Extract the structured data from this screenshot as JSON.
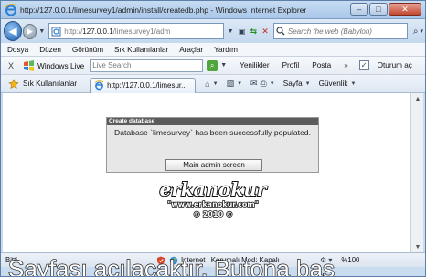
{
  "window": {
    "title": "http://127.0.0.1/limesurvey1/admin/install/createdb.php - Windows Internet Explorer",
    "minimize": "–",
    "maximize": "□",
    "close": "✕"
  },
  "nav": {
    "address_dim_prefix": "http://",
    "address_host": "127.0.0.1",
    "address_dim_suffix": "/limesurvey1/adm",
    "search_placeholder": "Search the web (Babylon)"
  },
  "menu": {
    "items": [
      "Dosya",
      "Düzen",
      "Görünüm",
      "Sık Kullanılanlar",
      "Araçlar",
      "Yardım"
    ]
  },
  "windows_live": {
    "close": "X",
    "name": "Windows Live",
    "search_placeholder": "Live Search",
    "links": [
      "Yenilikler",
      "Profil",
      "Posta"
    ],
    "more": "»",
    "sign_in": "Oturum aç"
  },
  "favorites": {
    "label": "Sık Kullanılanlar",
    "tab_title": "http://127.0.0.1/limesur...",
    "page_menu": "Sayfa",
    "security_menu": "Güvenlik"
  },
  "dialog": {
    "header": "Create database",
    "message": "Database `limesurvey` has been successfully populated.",
    "button": "Main admin screen"
  },
  "brand": {
    "name": "erkanokur",
    "url": "\"www.erkanokur.com\"",
    "copyright": "© 2010 ©"
  },
  "status": {
    "left": "Bitti",
    "zone": "Internet | Korumalı Mod: Kapalı",
    "zoom": "%100"
  },
  "caption": {
    "text": "Sayfası açılacaktır. Butona bas"
  },
  "colors": {
    "dialog_header": "#5c5c5c",
    "dialog_body": "#e7e7e7",
    "chrome_blue": "#c4d8ee"
  }
}
